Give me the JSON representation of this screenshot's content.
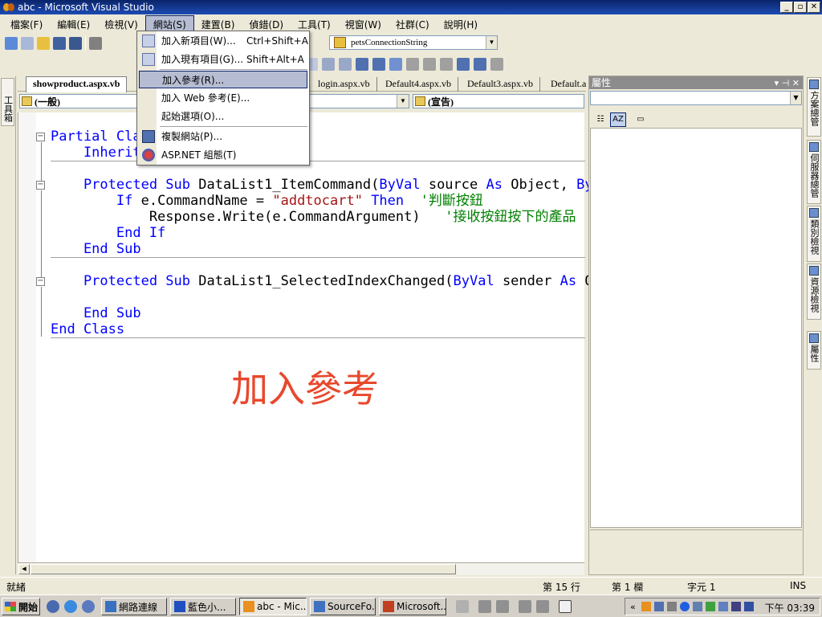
{
  "window": {
    "title": "abc - Microsoft Visual Studio"
  },
  "menubar": [
    "檔案(F)",
    "編輯(E)",
    "檢視(V)",
    "網站(S)",
    "建置(B)",
    "偵錯(D)",
    "工具(T)",
    "視窗(W)",
    "社群(C)",
    "說明(H)"
  ],
  "toolbar": {
    "connection": "petsConnectionString"
  },
  "toolbox": {
    "label": "工具箱"
  },
  "doc_tabs": [
    "showproduct.aspx.vb",
    "login.aspx.vb",
    "Default4.aspx.vb",
    "Default3.aspx.vb",
    "Default.a"
  ],
  "class_combo": "(一般)",
  "member_combo": "(宣告)",
  "code": [
    [
      [
        "kw",
        "Partial Cla"
      ]
    ],
    [
      [
        "kw",
        "    Inherit"
      ]
    ],
    [],
    [
      [
        "kw",
        "    Protected Sub "
      ],
      [
        "txt",
        "DataList1_ItemCommand("
      ],
      [
        "kw",
        "ByVal"
      ],
      [
        "txt",
        " source "
      ],
      [
        "kw",
        "As"
      ],
      [
        "txt",
        " Object, "
      ],
      [
        "kw",
        "ByV"
      ]
    ],
    [
      [
        "kw",
        "        If "
      ],
      [
        "txt",
        "e.CommandName = "
      ],
      [
        "str",
        "\"addtocart\""
      ],
      [
        "kw",
        " Then"
      ],
      [
        "cmt",
        "  '判斷按鈕"
      ]
    ],
    [
      [
        "txt",
        "            Response.Write(e.CommandArgument)"
      ],
      [
        "cmt",
        "   '接收按鈕按下的產品"
      ]
    ],
    [
      [
        "kw",
        "        End If"
      ]
    ],
    [
      [
        "kw",
        "    End Sub"
      ]
    ],
    [],
    [
      [
        "kw",
        "    Protected Sub "
      ],
      [
        "txt",
        "DataList1_SelectedIndexChanged("
      ],
      [
        "kw",
        "ByVal"
      ],
      [
        "txt",
        " sender "
      ],
      [
        "kw",
        "As"
      ],
      [
        "txt",
        " Ob"
      ]
    ],
    [],
    [
      [
        "kw",
        "    End Sub"
      ]
    ],
    [
      [
        "kw",
        "End Class"
      ]
    ]
  ],
  "overlay_text": "加入參考",
  "dropdown": [
    {
      "label": "加入新項目(W)...",
      "shortcut": "Ctrl+Shift+A"
    },
    {
      "label": "加入現有項目(G)...",
      "shortcut": "Shift+Alt+A"
    },
    {
      "label": "加入參考(R)...",
      "shortcut": ""
    },
    {
      "label": "加入 Web 參考(E)...",
      "shortcut": ""
    },
    {
      "label": "起始選項(O)...",
      "shortcut": ""
    },
    {
      "label": "複製網站(P)...",
      "shortcut": ""
    },
    {
      "label": "ASP.NET 組態(T)",
      "shortcut": ""
    }
  ],
  "properties": {
    "title": "屬性"
  },
  "right_tabs": [
    "方案總管",
    "伺服器總管",
    "類別檢視",
    "資源檢視",
    "屬性"
  ],
  "status": {
    "ready": "就緒",
    "line": "第 15 行",
    "col": "第 1 欄",
    "char": "字元 1",
    "mode": "INS"
  },
  "taskbar": {
    "start": "開始",
    "tasks": [
      "網路連線",
      "藍色小...",
      "abc - Mic...",
      "SourceFo...",
      "Microsoft..."
    ],
    "clock": "下午 03:39"
  },
  "colors": {
    "keyword": "#0000ff",
    "string": "#a31515",
    "comment": "#008000",
    "overlay": "#e8482c",
    "menu_highlight": "#b6bdd2"
  }
}
